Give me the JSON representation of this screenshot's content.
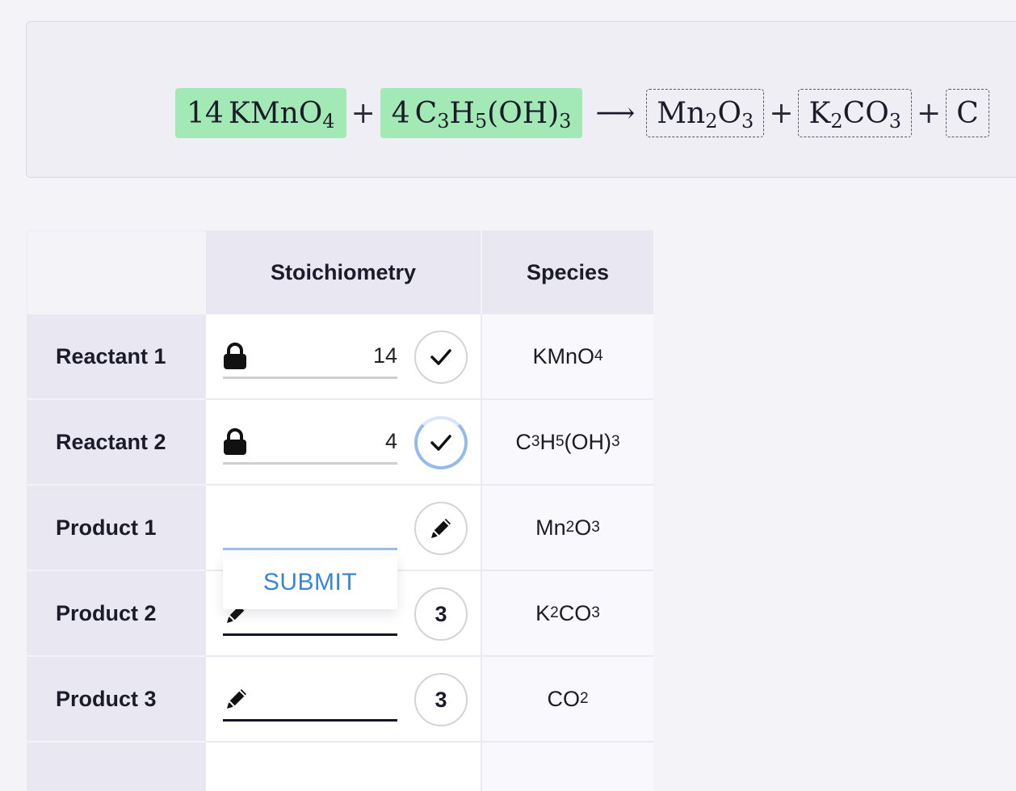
{
  "equation": {
    "reactants": [
      {
        "coef": "14",
        "base": "KMnO",
        "sub": "4",
        "state": "solved"
      },
      {
        "coef": "4",
        "pre1": "C",
        "s1": "3",
        "pre2": "H",
        "s2": "5",
        "post": "(OH)",
        "s3": "3",
        "state": "solved"
      }
    ],
    "plus": "+",
    "arrow": "⟶",
    "products": [
      {
        "text": "Mn₂O₃",
        "state": "unsolved"
      },
      {
        "text": "K₂CO₃",
        "state": "unsolved"
      },
      {
        "text": "C",
        "state": "unsolved"
      }
    ]
  },
  "table": {
    "headers": {
      "stoichiometry": "Stoichiometry",
      "species": "Species"
    },
    "rows": [
      {
        "label": "Reactant 1",
        "value": "14",
        "icon": "lock-icon",
        "badge": "check-icon",
        "species": {
          "a": "KMnO",
          "a_sub": "4"
        }
      },
      {
        "label": "Reactant 2",
        "value": "4",
        "icon": "lock-icon",
        "badge": "check-icon",
        "species": {
          "a": "C",
          "a_sub": "3",
          "b": "H",
          "b_sub": "5",
          "c": "(OH)",
          "c_sub": "3"
        }
      },
      {
        "label": "Product 1",
        "value": "",
        "icon": "",
        "badge": "pencil-icon",
        "species": {
          "a": "Mn",
          "a_sub": "2",
          "b": "O",
          "b_sub": "3"
        }
      },
      {
        "label": "Product 2",
        "value": "",
        "icon": "pencil-icon",
        "badge_text": "3",
        "species": {
          "a": "K",
          "a_sub": "2",
          "b": "CO",
          "b_sub": "3"
        }
      },
      {
        "label": "Product 3",
        "value": "",
        "icon": "pencil-icon",
        "badge_text": "3",
        "species": {
          "a": "CO",
          "a_sub": "2"
        }
      }
    ]
  },
  "popup": {
    "submit_label": "SUBMIT"
  },
  "colors": {
    "solved_highlight": "#a3e9b5",
    "accent_blue": "#3a86d6",
    "header_bg": "#e9e7f2"
  }
}
